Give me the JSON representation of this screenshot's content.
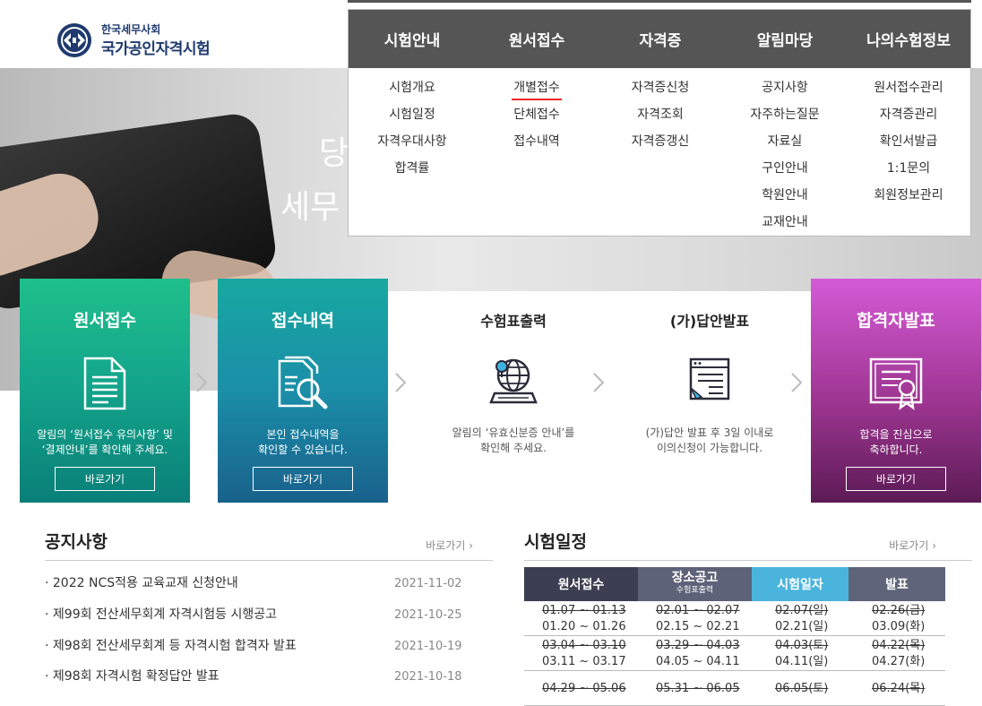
{
  "logo": {
    "small": "한국세무사회",
    "big": "국가공인자격시험"
  },
  "hero": {
    "line1": "당",
    "line2": "세무"
  },
  "nav": {
    "menus": [
      {
        "label": "시험안내",
        "items": [
          "시험개요",
          "시험일정",
          "자격우대사항",
          "합격률"
        ]
      },
      {
        "label": "원서접수",
        "items": [
          "개별접수",
          "단체접수",
          "접수내역"
        ],
        "active_item": "개별접수"
      },
      {
        "label": "자격증",
        "items": [
          "자격증신청",
          "자격조회",
          "자격증갱신"
        ]
      },
      {
        "label": "알림마당",
        "items": [
          "공지사항",
          "자주하는질문",
          "자료실",
          "구인안내",
          "학원안내",
          "교재안내"
        ]
      },
      {
        "label": "나의수험정보",
        "items": [
          "원서접수관리",
          "자격증관리",
          "확인서발급",
          "1:1문의",
          "회원정보관리"
        ]
      }
    ]
  },
  "process": {
    "steps": [
      {
        "title": "원서접수",
        "desc1": "알림의 ‘원서접수 유의사항’ 및",
        "desc2": "‘결제안내’를 확인해 주세요.",
        "button": "바로가기",
        "icon": "document-icon"
      },
      {
        "title": "접수내역",
        "desc1": "본인 접수내역을",
        "desc2": "확인할 수 있습니다.",
        "button": "바로가기",
        "icon": "search-document-icon"
      },
      {
        "title": "수험표출력",
        "desc1": "알림의 ‘유효신분증 안내’를",
        "desc2": "확인해 주세요.",
        "icon": "globe-laptop-icon"
      },
      {
        "title": "(가)답안발표",
        "desc1": "(가)답안 발표 후 3일 이내로",
        "desc2": "이의신청이 가능합니다.",
        "icon": "answer-sheet-icon"
      },
      {
        "title": "합격자발표",
        "desc1": "합격을 진심으로",
        "desc2": "축하합니다.",
        "button": "바로가기",
        "icon": "certificate-icon"
      }
    ]
  },
  "notice": {
    "title": "공지사항",
    "more": "바로가기 ›",
    "items": [
      {
        "title": "· 2022 NCS적용 교육교재 신청안내",
        "date": "2021-11-02"
      },
      {
        "title": "· 제99회 전산세무회계 자격시험등 시행공고",
        "date": "2021-10-25"
      },
      {
        "title": "· 제98회 전산세무회계 등 자격시험 합격자 발표",
        "date": "2021-10-19"
      },
      {
        "title": "· 제98회 자격시험 확정답안 발표",
        "date": "2021-10-18"
      }
    ]
  },
  "schedule": {
    "title": "시험일정",
    "more": "바로가기 ›",
    "headers": {
      "h1": "원서접수",
      "h2": "장소공고",
      "h2_sub": "수험표출력",
      "h3": "시험일자",
      "h4": "발표"
    },
    "rows": [
      {
        "c1_old": "01.07 ~ 01.13",
        "c1_new": "01.20 ~ 01.26",
        "c2_old": "02.01 ~ 02.07",
        "c2_new": "02.15 ~ 02.21",
        "c3_old": "02.07(일)",
        "c3_new": "02.21(일)",
        "c4_old": "02.26(금)",
        "c4_new": "03.09(화)"
      },
      {
        "c1_old": "03.04 ~ 03.10",
        "c1_new": "03.11 ~ 03.17",
        "c2_old": "03.29 ~ 04.03",
        "c2_new": "04.05 ~ 04.11",
        "c3_old": "04.03(토)",
        "c3_new": "04.11(일)",
        "c4_old": "04.22(목)",
        "c4_new": "04.27(화)"
      },
      {
        "c1_old": "04.29 ~ 05.06",
        "c1_new": "",
        "c2_old": "05.31 ~ 06.05",
        "c2_new": "",
        "c3_old": "06.05(토)",
        "c3_new": "",
        "c4_old": "06.24(목)",
        "c4_new": ""
      }
    ]
  },
  "colors": {
    "nav_bg": "#555555",
    "active_underline": "#e8292d",
    "green": "#14a68c",
    "teal": "#1b8ea8",
    "purple": "#9d3591",
    "logo": "#1e3a6e"
  }
}
